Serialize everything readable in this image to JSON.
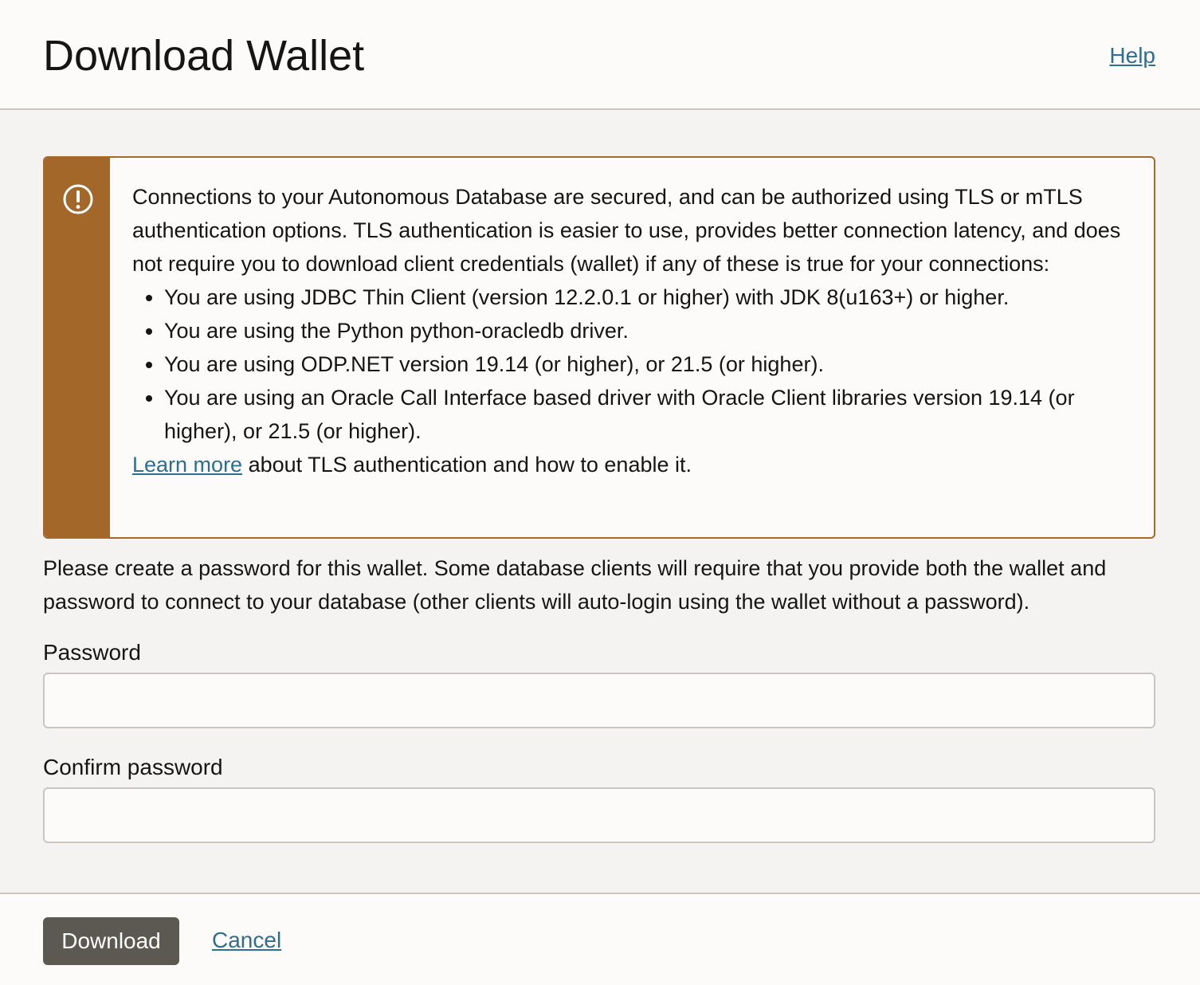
{
  "header": {
    "title": "Download Wallet",
    "help_label": "Help"
  },
  "warning": {
    "icon": "exclamation-circle-icon",
    "accent_color": "#a3672a",
    "intro": "Connections to your Autonomous Database are secured, and can be authorized using TLS or mTLS authentication options. TLS authentication is easier to use, provides better connection latency, and does not require you to download client credentials (wallet) if any of these is true for your connections:",
    "items": [
      "You are using JDBC Thin Client (version 12.2.0.1 or higher) with JDK 8(u163+) or higher.",
      "You are using the Python python-oracledb driver.",
      "You are using ODP.NET version 19.14 (or higher), or 21.5 (or higher).",
      "You are using an Oracle Call Interface based driver with Oracle Client libraries version 19.14 (or higher), or 21.5 (or higher)."
    ],
    "learn_more_label": "Learn more",
    "learn_more_suffix": " about TLS authentication and how to enable it."
  },
  "instructions": "Please create a password for this wallet. Some database clients will require that you provide both the wallet and password to connect to your database (other clients will auto-login using the wallet without a password).",
  "form": {
    "password_label": "Password",
    "password_value": "",
    "confirm_label": "Confirm password",
    "confirm_value": ""
  },
  "footer": {
    "download_label": "Download",
    "cancel_label": "Cancel"
  },
  "colors": {
    "link": "#2f6e8e",
    "button": "#5c5852"
  }
}
